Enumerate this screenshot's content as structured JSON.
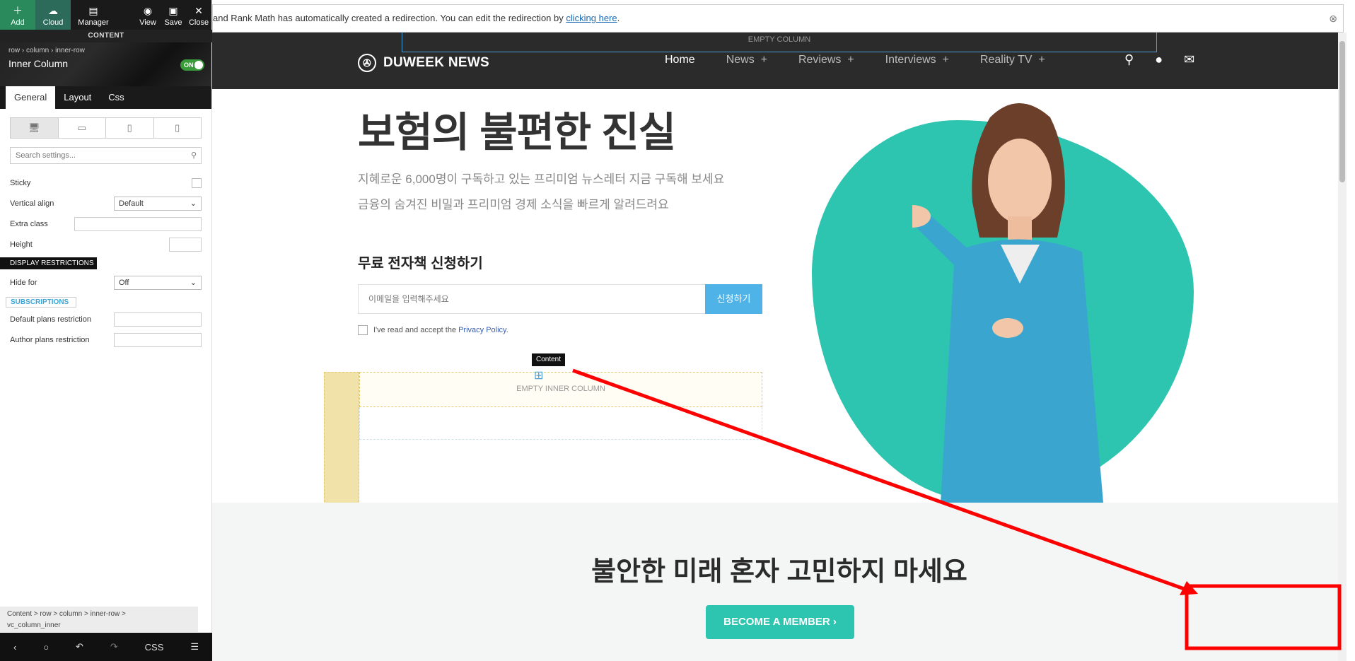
{
  "builder": {
    "toolbar": {
      "add": "Add",
      "cloud": "Cloud",
      "manager": "Manager",
      "view": "View",
      "save": "Save",
      "close": "Close"
    },
    "section_label": "CONTENT",
    "breadcrumb_top": "row › column › inner-row",
    "element_name": "Inner Column",
    "toggle_label": "ON",
    "tabs": [
      "General",
      "Layout",
      "Css"
    ],
    "search_placeholder": "Search settings...",
    "fields": {
      "sticky": "Sticky",
      "vertical_align": "Vertical align",
      "vertical_align_value": "Default",
      "extra_class": "Extra class",
      "height": "Height",
      "display_restrictions": "DISPLAY RESTRICTIONS",
      "hide_for": "Hide for",
      "hide_for_value": "Off",
      "subscriptions": "SUBSCRIPTIONS",
      "default_plans": "Default plans restriction",
      "author_plans": "Author plans restriction"
    },
    "bottom_breadcrumb_line1": "Content > row > column > inner-row >",
    "bottom_breadcrumb_line2": "vc_column_inner",
    "bottom_css": "CSS"
  },
  "site": {
    "notice_text": "and Rank Math has automatically created a redirection. You can edit the redirection by ",
    "notice_link": "clicking here",
    "notice_end": ".",
    "empty_column": "EMPTY COLUMN",
    "logo": "DUWEEK NEWS",
    "menu": [
      {
        "label": "Home",
        "plus": ""
      },
      {
        "label": "News",
        "plus": "+"
      },
      {
        "label": "Reviews",
        "plus": "+"
      },
      {
        "label": "Interviews",
        "plus": "+"
      },
      {
        "label": "Reality TV",
        "plus": "+"
      }
    ],
    "hero_title": "보험의 불편한 진실",
    "hero_sub_1": "지혜로운 6,000명이 구독하고 있는 프리미엄 뉴스레터 지금 구독해 보세요",
    "hero_sub_2": "금융의 숨겨진 비밀과 프리미엄 경제 소식을 빠르게 알려드려요",
    "form_heading": "무료 전자책 신청하기",
    "email_placeholder": "이메일을 입력해주세요",
    "subscribe_btn": "신청하기",
    "consent_text": "I've read and accept the",
    "consent_link": "Privacy Policy.",
    "tooltip": "Content",
    "empty_inner_column": "EMPTY INNER COLUMN",
    "section2_heading": "불안한 미래 혼자 고민하지 마세요",
    "member_btn": "BECOME A MEMBER  ›"
  },
  "colors": {
    "accent_teal": "#2dc5b0",
    "subscribe_blue": "#4fb3e8",
    "annotation_red": "#ff0000",
    "nav_dark": "#2b2b2b"
  }
}
